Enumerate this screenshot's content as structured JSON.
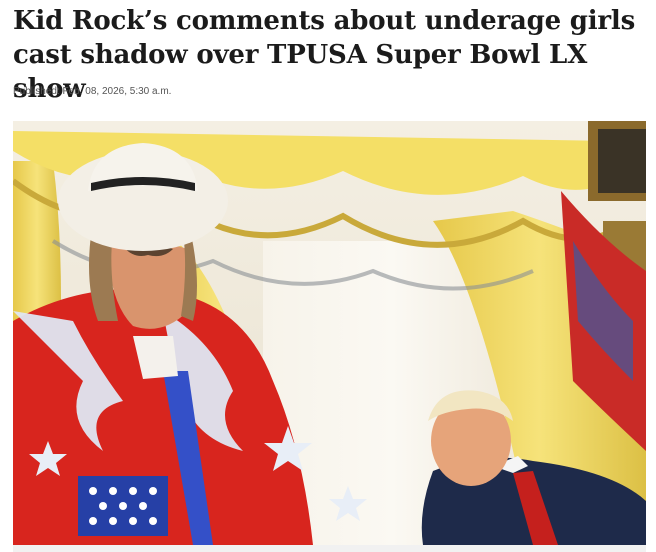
{
  "article": {
    "headline": "Kid Rock’s comments about underage girls cast shadow over TPUSA Super Bowl LX show",
    "published_label": "Published:",
    "published_date": "Feb. 08, 2026, 5:30 a.m."
  },
  "image": {
    "icon": "news-photo",
    "subjects": [
      "man in white hat and sunglasses wearing red star-spangled jacket",
      "man in dark suit and red tie seated"
    ],
    "colors": {
      "curtain": "#f1dc5c",
      "jacket": "#d8251e",
      "hat": "#f3efe6",
      "suit": "#1e2a4a",
      "tie": "#c5201d"
    }
  }
}
